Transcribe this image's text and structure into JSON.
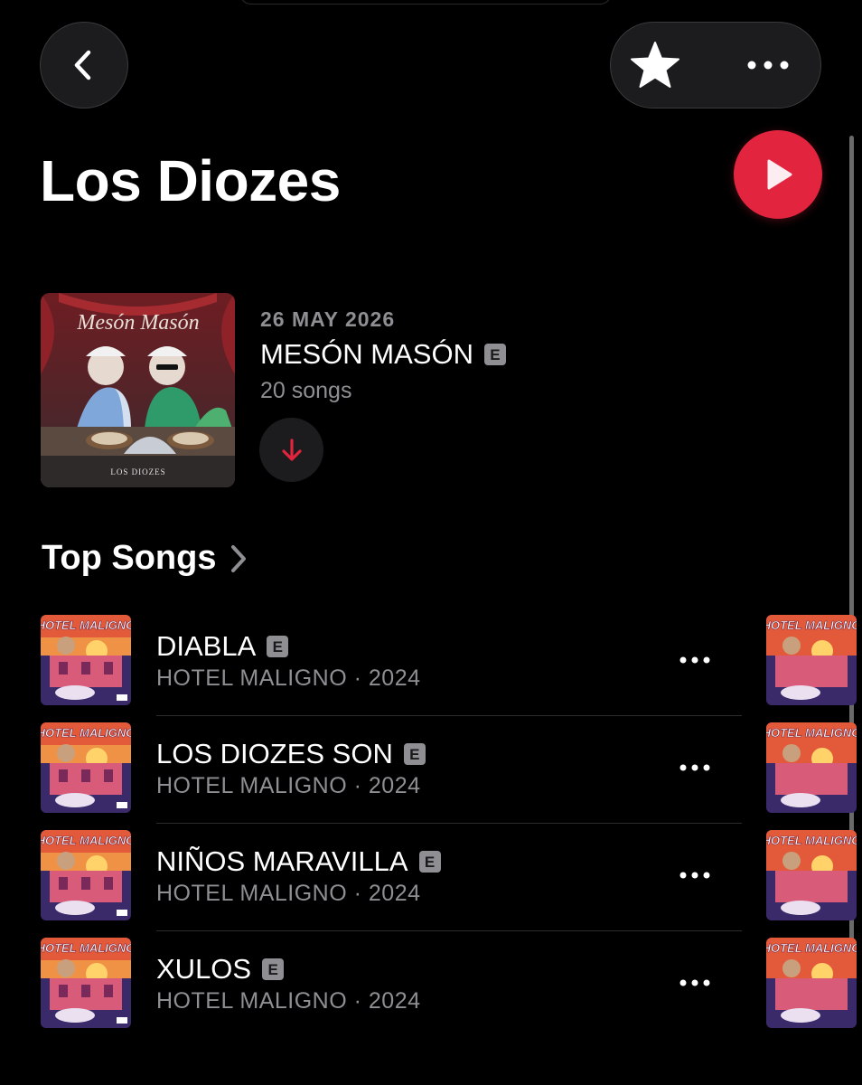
{
  "artist": {
    "name": "Los Diozes"
  },
  "toolbar": {
    "back_icon": "chevron-left-icon",
    "favorite_icon": "star-icon",
    "more_icon": "ellipsis-icon",
    "play_icon": "play-icon"
  },
  "latest_release": {
    "date": "26 MAY 2026",
    "title": "MESÓN MASÓN",
    "explicit": "E",
    "song_count": "20 songs",
    "cover_title": "Mesón Masón",
    "cover_artist": "LOS DIOZES",
    "download_icon": "arrow-down-icon"
  },
  "top_songs": {
    "title": "Top Songs",
    "items": [
      {
        "title": "DIABLA",
        "explicit": "E",
        "album": "HOTEL MALIGNO",
        "year": "2024",
        "subtitle": "HOTEL MALIGNO · 2024",
        "cover_text": "HOTEL MALIGNO"
      },
      {
        "title": "LOS DIOZES SON",
        "explicit": "E",
        "album": "HOTEL MALIGNO",
        "year": "2024",
        "subtitle": "HOTEL MALIGNO · 2024",
        "cover_text": "HOTEL MALIGNO"
      },
      {
        "title": "NIÑOS MARAVILLA",
        "explicit": "E",
        "album": "HOTEL MALIGNO",
        "year": "2024",
        "subtitle": "HOTEL MALIGNO · 2024",
        "cover_text": "HOTEL MALIGNO"
      },
      {
        "title": "XULOS",
        "explicit": "E",
        "album": "HOTEL MALIGNO",
        "year": "2024",
        "subtitle": "HOTEL MALIGNO · 2024",
        "cover_text": "HOTEL MALIGNO"
      }
    ]
  },
  "colors": {
    "background": "#000000",
    "accent": "#e2243f",
    "secondary_text": "#8e8e93",
    "button_bg": "#1c1c1e"
  }
}
